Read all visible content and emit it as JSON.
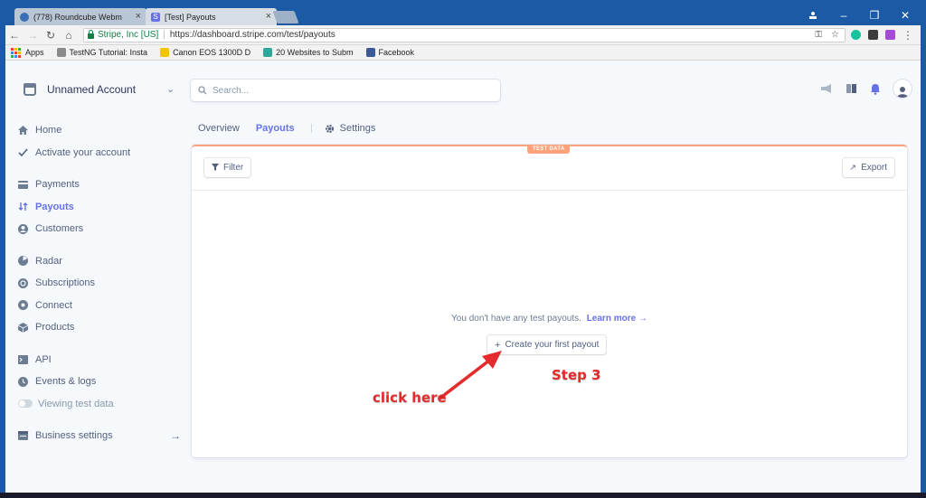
{
  "browser": {
    "tabs": [
      {
        "title": "(778) Roundcube Webm",
        "active": false
      },
      {
        "title": "[Test] Payouts",
        "active": true
      }
    ],
    "secure_label": "Stripe, Inc [US]",
    "url": "https://dashboard.stripe.com/test/payouts",
    "bookmarks": [
      {
        "label": "Apps",
        "icon": "apps-grid-icon"
      },
      {
        "label": "TestNG Tutorial: Insta",
        "icon": "testng-icon"
      },
      {
        "label": "Canon EOS 1300D D",
        "icon": "canon-icon"
      },
      {
        "label": "20 Websites to Subm",
        "icon": "website-icon"
      },
      {
        "label": "Facebook",
        "icon": "facebook-icon"
      }
    ]
  },
  "header": {
    "account_name": "Unnamed Account",
    "search_placeholder": "Search..."
  },
  "sidebar": {
    "groups": [
      [
        {
          "label": "Home",
          "icon": "home-icon"
        },
        {
          "label": "Activate your account",
          "icon": "check-icon"
        }
      ],
      [
        {
          "label": "Payments",
          "icon": "payments-icon"
        },
        {
          "label": "Payouts",
          "icon": "payouts-icon",
          "active": true
        },
        {
          "label": "Customers",
          "icon": "customers-icon"
        }
      ],
      [
        {
          "label": "Radar",
          "icon": "radar-icon"
        },
        {
          "label": "Subscriptions",
          "icon": "subscriptions-icon"
        },
        {
          "label": "Connect",
          "icon": "connect-icon"
        },
        {
          "label": "Products",
          "icon": "products-icon"
        }
      ],
      [
        {
          "label": "API",
          "icon": "api-icon"
        },
        {
          "label": "Events & logs",
          "icon": "events-icon"
        },
        {
          "label": "Viewing test data",
          "icon": "toggle-icon"
        }
      ],
      [
        {
          "label": "Business settings",
          "icon": "business-icon"
        }
      ]
    ]
  },
  "main": {
    "tabs": [
      {
        "label": "Overview"
      },
      {
        "label": "Payouts",
        "active": true
      },
      {
        "label": "Settings"
      }
    ],
    "badge": "TEST DATA",
    "filter_label": "Filter",
    "export_label": "Export",
    "empty_text": "You don't have any test payouts.",
    "learn_more": "Learn more →",
    "create_label": "Create your first payout"
  },
  "annotations": {
    "click_here": "click here",
    "step": "Step 3"
  },
  "colors": {
    "accent": "#6772e5",
    "test_badge": "#ffa27b",
    "annotation_red": "#e52b2b",
    "window_blue": "#1c5aa6"
  }
}
